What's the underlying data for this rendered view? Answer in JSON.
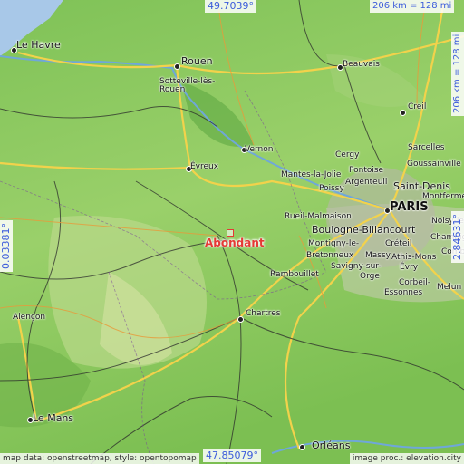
{
  "map": {
    "coords": {
      "top": "49.7039°",
      "bottom": "47.85079°",
      "left": "0.03381°",
      "right": "2.84631°"
    },
    "scale": {
      "top": "206 km = 128 mi",
      "right": "206 km = 128 mi"
    },
    "target": "Abondant",
    "places": {
      "le_havre": "Le Havre",
      "rouen": "Rouen",
      "sotteville": "Sotteville-lès-Rouen",
      "beauvais": "Beauvais",
      "creil": "Creil",
      "vernon": "Vernon",
      "cergy": "Cergy",
      "sarcelles": "Sarcelles",
      "goussainville": "Goussainville",
      "evreux": "Évreux",
      "mantes": "Mantes-la-Jolie",
      "pontoise": "Pontoise",
      "poissy": "Poissy",
      "argenteuil": "Argenteuil",
      "saint_denis": "Saint-Denis",
      "montfermeil": "Montfermeil",
      "paris": "PARIS",
      "rueil": "Rueil-Malmaison",
      "noisy": "Noisy-le-",
      "boulogne": "Boulogne-Billancourt",
      "montigny": "Montigny-le-",
      "creteil": "Créteil",
      "bretonneux": "Bretonneux",
      "massy": "Massy",
      "champigny": "Champig",
      "savigny": "Savigny-sur-",
      "athis": "Athis-Mons",
      "orge": "Orge",
      "evry": "Évry",
      "combs": "Comb",
      "rambouillet": "Rambouillet",
      "corbeil": "Corbeil-",
      "essonnes": "Essonnes",
      "melun": "Melun",
      "alencon": "Alençon",
      "chartres": "Chartres",
      "le_mans": "Le Mans",
      "orleans": "Orléans"
    },
    "credits": {
      "left": "map data: openstreetmap, style: opentopomap",
      "right": "image proc.: elevation.city"
    }
  }
}
